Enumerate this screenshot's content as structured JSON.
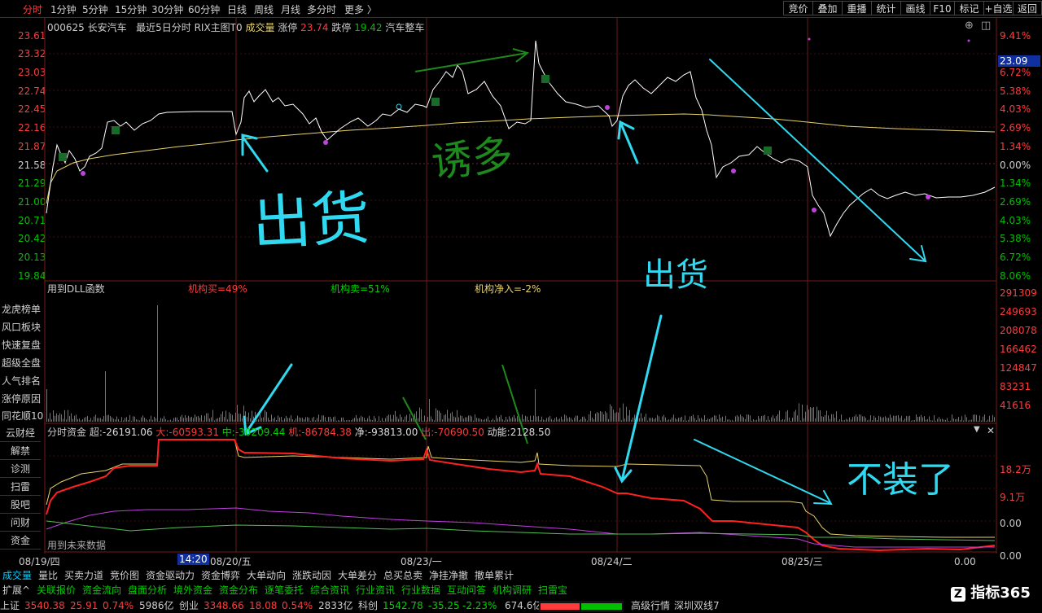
{
  "period_tabs": [
    "分时",
    "1分钟",
    "5分钟",
    "15分钟",
    "30分钟",
    "60分钟",
    "日线",
    "周线",
    "月线",
    "多分时",
    "更多 〉"
  ],
  "right_buttons": [
    "竞价",
    "叠加",
    "重播",
    "统计",
    "画线",
    "F10",
    "标记",
    "+自选",
    "返回"
  ],
  "info": {
    "code": "000625",
    "name": "长安汽车",
    "title": "最近5日分时",
    "indicator": "RIX主图T0",
    "vol_label": "成交量",
    "up_limit_label": "涨停",
    "up_limit": "23.74",
    "down_limit_label": "跌停",
    "down_limit": "19.42",
    "sector": "汽车整车"
  },
  "price_left": [
    "23.61",
    "23.32",
    "23.03",
    "22.74",
    "22.45",
    "22.16",
    "21.87",
    "21.58",
    "21.29",
    "21.00",
    "20.71",
    "20.42",
    "20.13",
    "19.84"
  ],
  "price_right": [
    "9.41%",
    "8.06%",
    "6.72%",
    "5.38%",
    "4.03%",
    "2.69%",
    "1.34%",
    "0.00%",
    "1.34%",
    "2.69%",
    "4.03%",
    "5.38%",
    "6.72%",
    "8.06%"
  ],
  "current_price": "23.09",
  "dll_label": "用到DLL函数",
  "inst": {
    "buy": "机构买=49%",
    "sell": "机构卖=51%",
    "net": "机构净入=-2%"
  },
  "volume_axis": [
    "291309",
    "249693",
    "208078",
    "166462",
    "124847",
    "83231",
    "41616"
  ],
  "side_menu": [
    "龙虎榜单",
    "风口板块",
    "快速复盘",
    "超级全盘",
    "人气排名",
    "涨停原因",
    "同花顺10"
  ],
  "side_menu2": [
    "云财经",
    "解禁",
    "诊测",
    "扫雷",
    "股吧",
    "问财",
    "资金"
  ],
  "fund": {
    "title": "分时资金",
    "super_label": "超:",
    "super": "-26191.06",
    "big_label": "大:",
    "big": "-60593.31",
    "mid_label": "中:",
    "mid": "-30209.44",
    "inst_label": "机:",
    "inst": "-86784.38",
    "net_label": "净:",
    "net": "-93813.00",
    "out_label": "出:",
    "out": "-70690.50",
    "power_label": "动能:",
    "power": "2128.50"
  },
  "fund_axis": [
    "18.2万",
    "9.1万",
    "0.00",
    "0.00"
  ],
  "future_label": "用到未来数据",
  "dates": [
    "08/19/四",
    "08/20/五",
    "08/23/一",
    "08/24/二",
    "08/25/三"
  ],
  "time_marker": "14:20",
  "bottom_value": "0.00",
  "bottom_tabs": [
    "成交量",
    "量比",
    "买卖力道",
    "竞价图",
    "资金驱动力",
    "资金博弈",
    "大单动向",
    "涨跌动因",
    "大单差分",
    "总买总卖",
    "净挂净撤",
    "撤单累计"
  ],
  "bottom_tabs2": [
    "扩展^",
    "关联报价",
    "资金流向",
    "盘面分析",
    "境外资金",
    "资金分布",
    "逐笔委托",
    "综合资讯",
    "行业资讯",
    "行业数据",
    "互动问答",
    "机构调研",
    "扫雷宝"
  ],
  "status": {
    "idx1_name": "上证",
    "idx1_val": "3540.38",
    "idx1_chg": "25.91",
    "idx1_pct": "0.74%",
    "idx1_amt": "5986亿",
    "idx2_name": "创业",
    "idx2_val": "3348.66",
    "idx2_chg": "18.08",
    "idx2_pct": "0.54%",
    "idx2_amt": "2833亿",
    "idx3_name": "科创",
    "idx3_val": "1542.78",
    "idx3_chg": "-35.25",
    "idx3_pct": "-2.23%",
    "idx3_amt": "674.6亿",
    "market": "高级行情",
    "twin": "深圳双线7"
  },
  "brand": "指标365",
  "annotations": {
    "sell1": "出货",
    "lure": "诱多",
    "sell2": "出货",
    "fake": "不装了"
  },
  "colors": {
    "up": "#ff3b3b",
    "down": "#00c000",
    "price_line": "#ffffff",
    "avg_line": "#e8d36a",
    "super": "#ff2020",
    "purple": "#c040e0",
    "cyan": "#30d8f0"
  }
}
